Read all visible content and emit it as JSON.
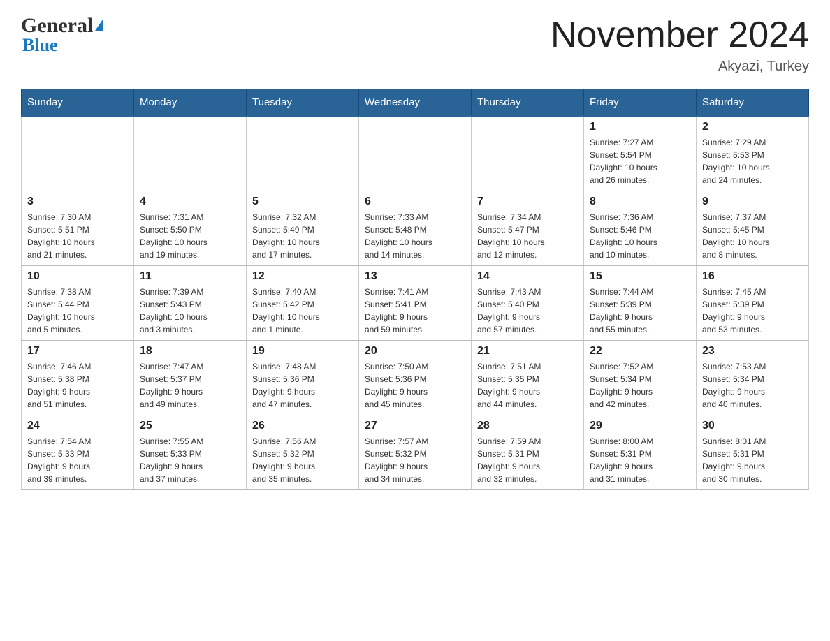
{
  "header": {
    "logo_general": "General",
    "logo_blue": "Blue",
    "month_title": "November 2024",
    "location": "Akyazi, Turkey"
  },
  "weekdays": [
    "Sunday",
    "Monday",
    "Tuesday",
    "Wednesday",
    "Thursday",
    "Friday",
    "Saturday"
  ],
  "weeks": [
    [
      {
        "day": "",
        "info": ""
      },
      {
        "day": "",
        "info": ""
      },
      {
        "day": "",
        "info": ""
      },
      {
        "day": "",
        "info": ""
      },
      {
        "day": "",
        "info": ""
      },
      {
        "day": "1",
        "info": "Sunrise: 7:27 AM\nSunset: 5:54 PM\nDaylight: 10 hours\nand 26 minutes."
      },
      {
        "day": "2",
        "info": "Sunrise: 7:29 AM\nSunset: 5:53 PM\nDaylight: 10 hours\nand 24 minutes."
      }
    ],
    [
      {
        "day": "3",
        "info": "Sunrise: 7:30 AM\nSunset: 5:51 PM\nDaylight: 10 hours\nand 21 minutes."
      },
      {
        "day": "4",
        "info": "Sunrise: 7:31 AM\nSunset: 5:50 PM\nDaylight: 10 hours\nand 19 minutes."
      },
      {
        "day": "5",
        "info": "Sunrise: 7:32 AM\nSunset: 5:49 PM\nDaylight: 10 hours\nand 17 minutes."
      },
      {
        "day": "6",
        "info": "Sunrise: 7:33 AM\nSunset: 5:48 PM\nDaylight: 10 hours\nand 14 minutes."
      },
      {
        "day": "7",
        "info": "Sunrise: 7:34 AM\nSunset: 5:47 PM\nDaylight: 10 hours\nand 12 minutes."
      },
      {
        "day": "8",
        "info": "Sunrise: 7:36 AM\nSunset: 5:46 PM\nDaylight: 10 hours\nand 10 minutes."
      },
      {
        "day": "9",
        "info": "Sunrise: 7:37 AM\nSunset: 5:45 PM\nDaylight: 10 hours\nand 8 minutes."
      }
    ],
    [
      {
        "day": "10",
        "info": "Sunrise: 7:38 AM\nSunset: 5:44 PM\nDaylight: 10 hours\nand 5 minutes."
      },
      {
        "day": "11",
        "info": "Sunrise: 7:39 AM\nSunset: 5:43 PM\nDaylight: 10 hours\nand 3 minutes."
      },
      {
        "day": "12",
        "info": "Sunrise: 7:40 AM\nSunset: 5:42 PM\nDaylight: 10 hours\nand 1 minute."
      },
      {
        "day": "13",
        "info": "Sunrise: 7:41 AM\nSunset: 5:41 PM\nDaylight: 9 hours\nand 59 minutes."
      },
      {
        "day": "14",
        "info": "Sunrise: 7:43 AM\nSunset: 5:40 PM\nDaylight: 9 hours\nand 57 minutes."
      },
      {
        "day": "15",
        "info": "Sunrise: 7:44 AM\nSunset: 5:39 PM\nDaylight: 9 hours\nand 55 minutes."
      },
      {
        "day": "16",
        "info": "Sunrise: 7:45 AM\nSunset: 5:39 PM\nDaylight: 9 hours\nand 53 minutes."
      }
    ],
    [
      {
        "day": "17",
        "info": "Sunrise: 7:46 AM\nSunset: 5:38 PM\nDaylight: 9 hours\nand 51 minutes."
      },
      {
        "day": "18",
        "info": "Sunrise: 7:47 AM\nSunset: 5:37 PM\nDaylight: 9 hours\nand 49 minutes."
      },
      {
        "day": "19",
        "info": "Sunrise: 7:48 AM\nSunset: 5:36 PM\nDaylight: 9 hours\nand 47 minutes."
      },
      {
        "day": "20",
        "info": "Sunrise: 7:50 AM\nSunset: 5:36 PM\nDaylight: 9 hours\nand 45 minutes."
      },
      {
        "day": "21",
        "info": "Sunrise: 7:51 AM\nSunset: 5:35 PM\nDaylight: 9 hours\nand 44 minutes."
      },
      {
        "day": "22",
        "info": "Sunrise: 7:52 AM\nSunset: 5:34 PM\nDaylight: 9 hours\nand 42 minutes."
      },
      {
        "day": "23",
        "info": "Sunrise: 7:53 AM\nSunset: 5:34 PM\nDaylight: 9 hours\nand 40 minutes."
      }
    ],
    [
      {
        "day": "24",
        "info": "Sunrise: 7:54 AM\nSunset: 5:33 PM\nDaylight: 9 hours\nand 39 minutes."
      },
      {
        "day": "25",
        "info": "Sunrise: 7:55 AM\nSunset: 5:33 PM\nDaylight: 9 hours\nand 37 minutes."
      },
      {
        "day": "26",
        "info": "Sunrise: 7:56 AM\nSunset: 5:32 PM\nDaylight: 9 hours\nand 35 minutes."
      },
      {
        "day": "27",
        "info": "Sunrise: 7:57 AM\nSunset: 5:32 PM\nDaylight: 9 hours\nand 34 minutes."
      },
      {
        "day": "28",
        "info": "Sunrise: 7:59 AM\nSunset: 5:31 PM\nDaylight: 9 hours\nand 32 minutes."
      },
      {
        "day": "29",
        "info": "Sunrise: 8:00 AM\nSunset: 5:31 PM\nDaylight: 9 hours\nand 31 minutes."
      },
      {
        "day": "30",
        "info": "Sunrise: 8:01 AM\nSunset: 5:31 PM\nDaylight: 9 hours\nand 30 minutes."
      }
    ]
  ]
}
